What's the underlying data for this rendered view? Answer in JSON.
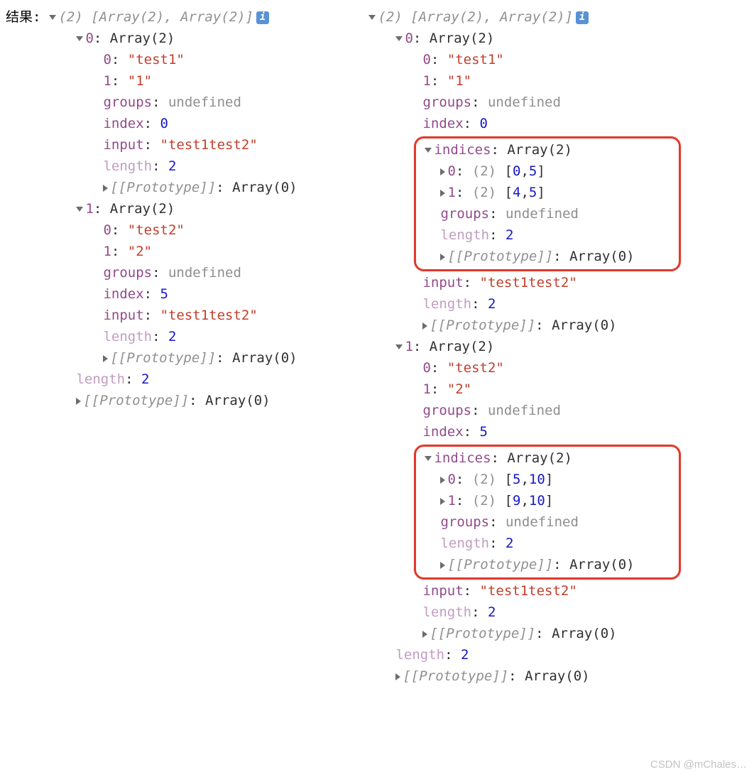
{
  "label": "结果:",
  "info_glyph": "i",
  "left": {
    "header_count": "(2)",
    "header_items": "[Array(2), Array(2)]",
    "items": [
      {
        "idx": "0",
        "type": "Array(2)",
        "v0": "\"test1\"",
        "v1": "\"1\"",
        "groups": "undefined",
        "index": "0",
        "input": "\"test1test2\"",
        "length": "2",
        "proto": "[[Prototype]]",
        "proto_v": "Array(0)"
      },
      {
        "idx": "1",
        "type": "Array(2)",
        "v0": "\"test2\"",
        "v1": "\"2\"",
        "groups": "undefined",
        "index": "5",
        "input": "\"test1test2\"",
        "length": "2",
        "proto": "[[Prototype]]",
        "proto_v": "Array(0)"
      }
    ],
    "outer_length": "2",
    "outer_proto": "[[Prototype]]",
    "outer_proto_v": "Array(0)"
  },
  "right": {
    "header_count": "(2)",
    "header_items": "[Array(2), Array(2)]",
    "items": [
      {
        "idx": "0",
        "type": "Array(2)",
        "v0": "\"test1\"",
        "v1": "\"1\"",
        "groups": "undefined",
        "index": "0",
        "indices_label": "indices",
        "indices_type": "Array(2)",
        "ind0_cnt": "(2)",
        "ind0_a": "0",
        "ind0_b": "5",
        "ind1_cnt": "(2)",
        "ind1_a": "4",
        "ind1_b": "5",
        "ind_groups": "undefined",
        "ind_length": "2",
        "ind_proto": "[[Prototype]]",
        "ind_proto_v": "Array(0)",
        "input": "\"test1test2\"",
        "length": "2",
        "proto": "[[Prototype]]",
        "proto_v": "Array(0)"
      },
      {
        "idx": "1",
        "type": "Array(2)",
        "v0": "\"test2\"",
        "v1": "\"2\"",
        "groups": "undefined",
        "index": "5",
        "indices_label": "indices",
        "indices_type": "Array(2)",
        "ind0_cnt": "(2)",
        "ind0_a": "5",
        "ind0_b": "10",
        "ind1_cnt": "(2)",
        "ind1_a": "9",
        "ind1_b": "10",
        "ind_groups": "undefined",
        "ind_length": "2",
        "ind_proto": "[[Prototype]]",
        "ind_proto_v": "Array(0)",
        "input": "\"test1test2\"",
        "length": "2",
        "proto": "[[Prototype]]",
        "proto_v": "Array(0)"
      }
    ],
    "outer_length": "2",
    "outer_proto": "[[Prototype]]",
    "outer_proto_v": "Array(0)"
  },
  "watermark": "CSDN @mChales…"
}
